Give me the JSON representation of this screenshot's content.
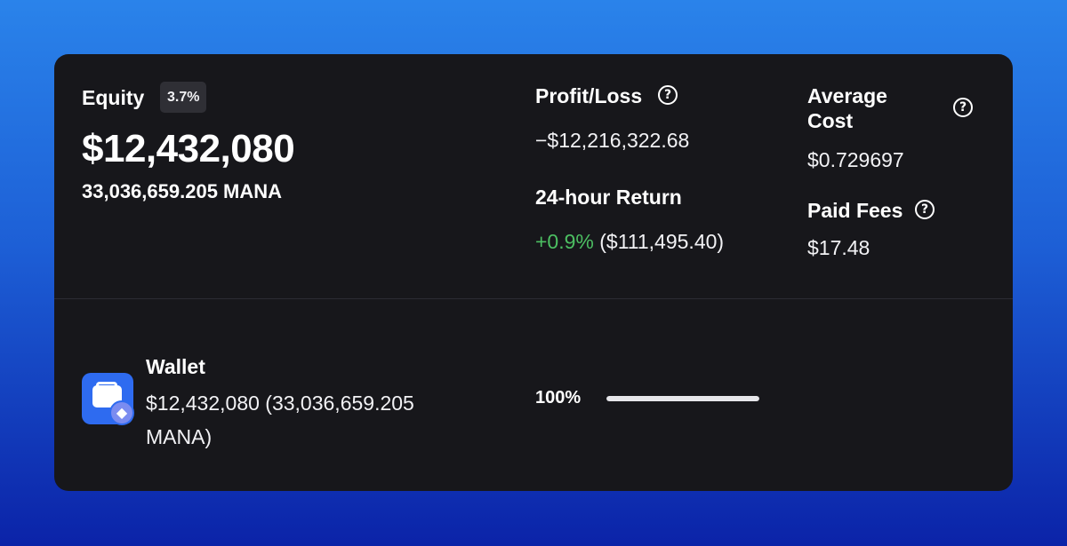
{
  "equity": {
    "label": "Equity",
    "badge": "3.7%",
    "value": "$12,432,080",
    "amount": "33,036,659.205 MANA"
  },
  "profit_loss": {
    "label": "Profit/Loss",
    "value": "−$12,216,322.68"
  },
  "return_24h": {
    "label": "24-hour Return",
    "percent": "+0.9%",
    "amount": "($111,495.40)"
  },
  "average_cost": {
    "label": "Average Cost",
    "value": "$0.729697"
  },
  "paid_fees": {
    "label": "Paid Fees",
    "value": "$17.48"
  },
  "wallet": {
    "title": "Wallet",
    "amount": "$12,432,080 (33,036,659.205 MANA)",
    "allocation_label": "100%",
    "allocation_fraction": 1.0,
    "icon": "wallet-icon",
    "badge_icon": "ethereum-icon"
  },
  "colors": {
    "positive": "#4cbf62",
    "accent": "#2e6bf0"
  }
}
